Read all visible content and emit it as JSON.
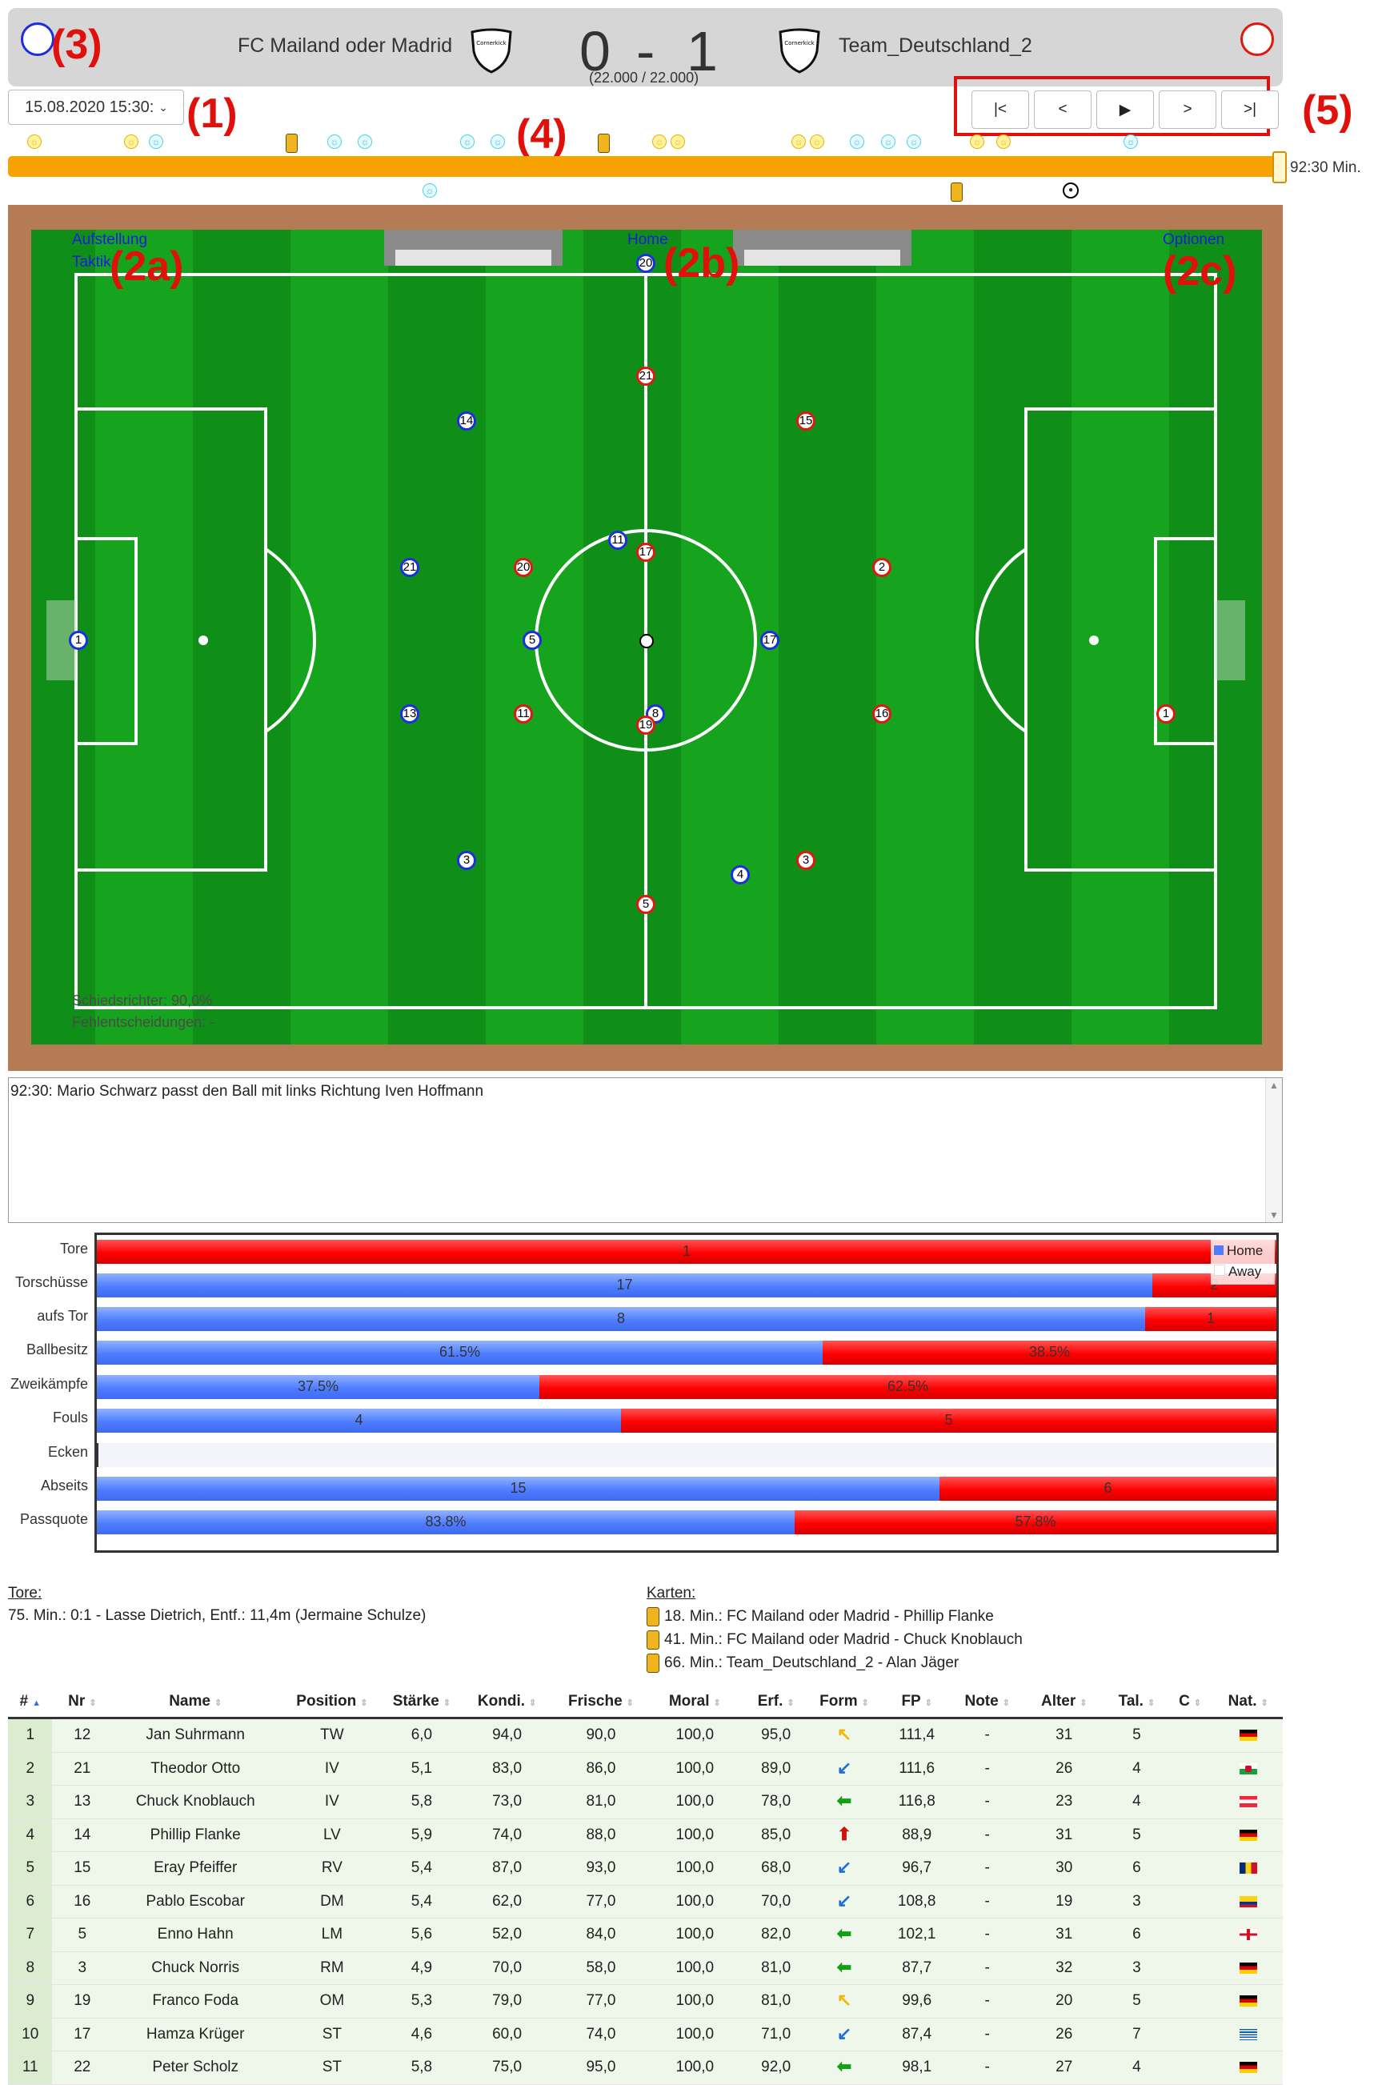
{
  "header": {
    "home_team": "FC Mailand oder Madrid",
    "away_team": "Team_Deutschland_2",
    "score_home": "0",
    "score_sep": "-",
    "score_away": "1",
    "attendance": "(22.000 / 22.000)",
    "crest_text": "Cornerkick",
    "home_color": "#1c2fe0",
    "away_color": "#e0180e"
  },
  "annotations": {
    "a1": "(1)",
    "a2a": "(2a)",
    "a2b": "(2b)",
    "a2c": "(2c)",
    "a3": "(3)",
    "a4": "(4)",
    "a5": "(5)"
  },
  "controls": {
    "date_value": "15.08.2020 15:30:",
    "nav_first": "|<",
    "nav_prev": "<",
    "nav_play": "▶",
    "nav_next": ">",
    "nav_last": ">|"
  },
  "timeline": {
    "time_label": "92:30 Min.",
    "progress": 1.0,
    "bar_color": "#f6a200"
  },
  "pitch": {
    "link_lineup": "Aufstellung",
    "link_tactic": "Taktik",
    "link_home": "Home",
    "link_options": "Optionen",
    "referee": "Schiedsrichter: 90,0%",
    "wrong_decisions": "Fehlentscheidungen: -",
    "home_players": [
      "1",
      "14",
      "21",
      "5",
      "13",
      "3",
      "11",
      "4",
      "17",
      "8"
    ],
    "away_players": [
      "20",
      "21",
      "15",
      "17",
      "20",
      "2",
      "11",
      "19",
      "16",
      "1",
      "3",
      "5"
    ]
  },
  "commentary": {
    "text": "92:30: Mario Schwarz passt den Ball mit links Richtung Iven Hoffmann"
  },
  "stats": {
    "legend_home": "Home",
    "legend_away": "Away",
    "rows": [
      {
        "label": "Tore",
        "home": 0,
        "away": 1,
        "home_text": "",
        "away_text": "1"
      },
      {
        "label": "Torschüsse",
        "home": 17,
        "away": 2,
        "home_text": "17",
        "away_text": "2"
      },
      {
        "label": "aufs Tor",
        "home": 8,
        "away": 1,
        "home_text": "8",
        "away_text": "1"
      },
      {
        "label": "Ballbesitz",
        "home": 61.5,
        "away": 38.5,
        "home_text": "61.5%",
        "away_text": "38.5%"
      },
      {
        "label": "Zweikämpfe",
        "home": 37.5,
        "away": 62.5,
        "home_text": "37.5%",
        "away_text": "62.5%"
      },
      {
        "label": "Fouls",
        "home": 4,
        "away": 5,
        "home_text": "4",
        "away_text": "5"
      },
      {
        "label": "Ecken",
        "home": 0,
        "away": 0,
        "home_text": "",
        "away_text": ""
      },
      {
        "label": "Abseits",
        "home": 15,
        "away": 6,
        "home_text": "15",
        "away_text": "6"
      },
      {
        "label": "Passquote",
        "home": 83.8,
        "away": 57.8,
        "home_text": "83.8%",
        "away_text": "57.8%"
      }
    ]
  },
  "goals": {
    "title": "Tore:",
    "items": [
      "75. Min.: 0:1 - Lasse Dietrich, Entf.: 11,4m (Jermaine Schulze)"
    ]
  },
  "cards": {
    "title": "Karten:",
    "items": [
      "18. Min.: FC Mailand oder Madrid - Phillip Flanke",
      "41. Min.: FC Mailand oder Madrid - Chuck Knoblauch",
      "66. Min.: Team_Deutschland_2 - Alan Jäger"
    ]
  },
  "table": {
    "headers": [
      "#",
      "Nr",
      "Name",
      "Position",
      "Stärke",
      "Kondi.",
      "Frische",
      "Moral",
      "Erf.",
      "Form",
      "FP",
      "Note",
      "Alter",
      "Tal.",
      "C",
      "Nat."
    ],
    "rows": [
      [
        "1",
        "12",
        "Jan Suhrmann",
        "TW",
        "6,0",
        "94,0",
        "90,0",
        "100,0",
        "95,0",
        "up-right",
        "111,4",
        "-",
        "31",
        "5",
        "",
        "DE"
      ],
      [
        "2",
        "21",
        "Theodor Otto",
        "IV",
        "5,1",
        "83,0",
        "86,0",
        "100,0",
        "89,0",
        "down-left",
        "111,6",
        "-",
        "26",
        "4",
        "",
        "WAL"
      ],
      [
        "3",
        "13",
        "Chuck Knoblauch",
        "IV",
        "5,8",
        "73,0",
        "81,0",
        "100,0",
        "78,0",
        "left",
        "116,8",
        "-",
        "23",
        "4",
        "",
        "AT"
      ],
      [
        "4",
        "14",
        "Phillip Flanke",
        "LV",
        "5,9",
        "74,0",
        "88,0",
        "100,0",
        "85,0",
        "up",
        "88,9",
        "-",
        "31",
        "5",
        "",
        "DE"
      ],
      [
        "5",
        "15",
        "Eray Pfeiffer",
        "RV",
        "5,4",
        "87,0",
        "93,0",
        "100,0",
        "68,0",
        "down-left",
        "96,7",
        "-",
        "30",
        "6",
        "",
        "RO"
      ],
      [
        "6",
        "16",
        "Pablo Escobar",
        "DM",
        "5,4",
        "62,0",
        "77,0",
        "100,0",
        "70,0",
        "down-left",
        "108,8",
        "-",
        "19",
        "3",
        "",
        "CO"
      ],
      [
        "7",
        "5",
        "Enno Hahn",
        "LM",
        "5,6",
        "52,0",
        "84,0",
        "100,0",
        "82,0",
        "left",
        "102,1",
        "-",
        "31",
        "6",
        "",
        "ENG"
      ],
      [
        "8",
        "3",
        "Chuck Norris",
        "RM",
        "4,9",
        "70,0",
        "58,0",
        "100,0",
        "81,0",
        "left",
        "87,7",
        "-",
        "32",
        "3",
        "",
        "DE"
      ],
      [
        "9",
        "19",
        "Franco Foda",
        "OM",
        "5,3",
        "79,0",
        "77,0",
        "100,0",
        "81,0",
        "up-right",
        "99,6",
        "-",
        "20",
        "5",
        "",
        "DE"
      ],
      [
        "10",
        "17",
        "Hamza Krüger",
        "ST",
        "4,6",
        "60,0",
        "74,0",
        "100,0",
        "71,0",
        "down-left",
        "87,4",
        "-",
        "26",
        "7",
        "",
        "GR"
      ],
      [
        "11",
        "22",
        "Peter Scholz",
        "ST",
        "5,8",
        "75,0",
        "95,0",
        "100,0",
        "92,0",
        "left",
        "98,1",
        "-",
        "27",
        "4",
        "",
        "DE"
      ]
    ]
  }
}
